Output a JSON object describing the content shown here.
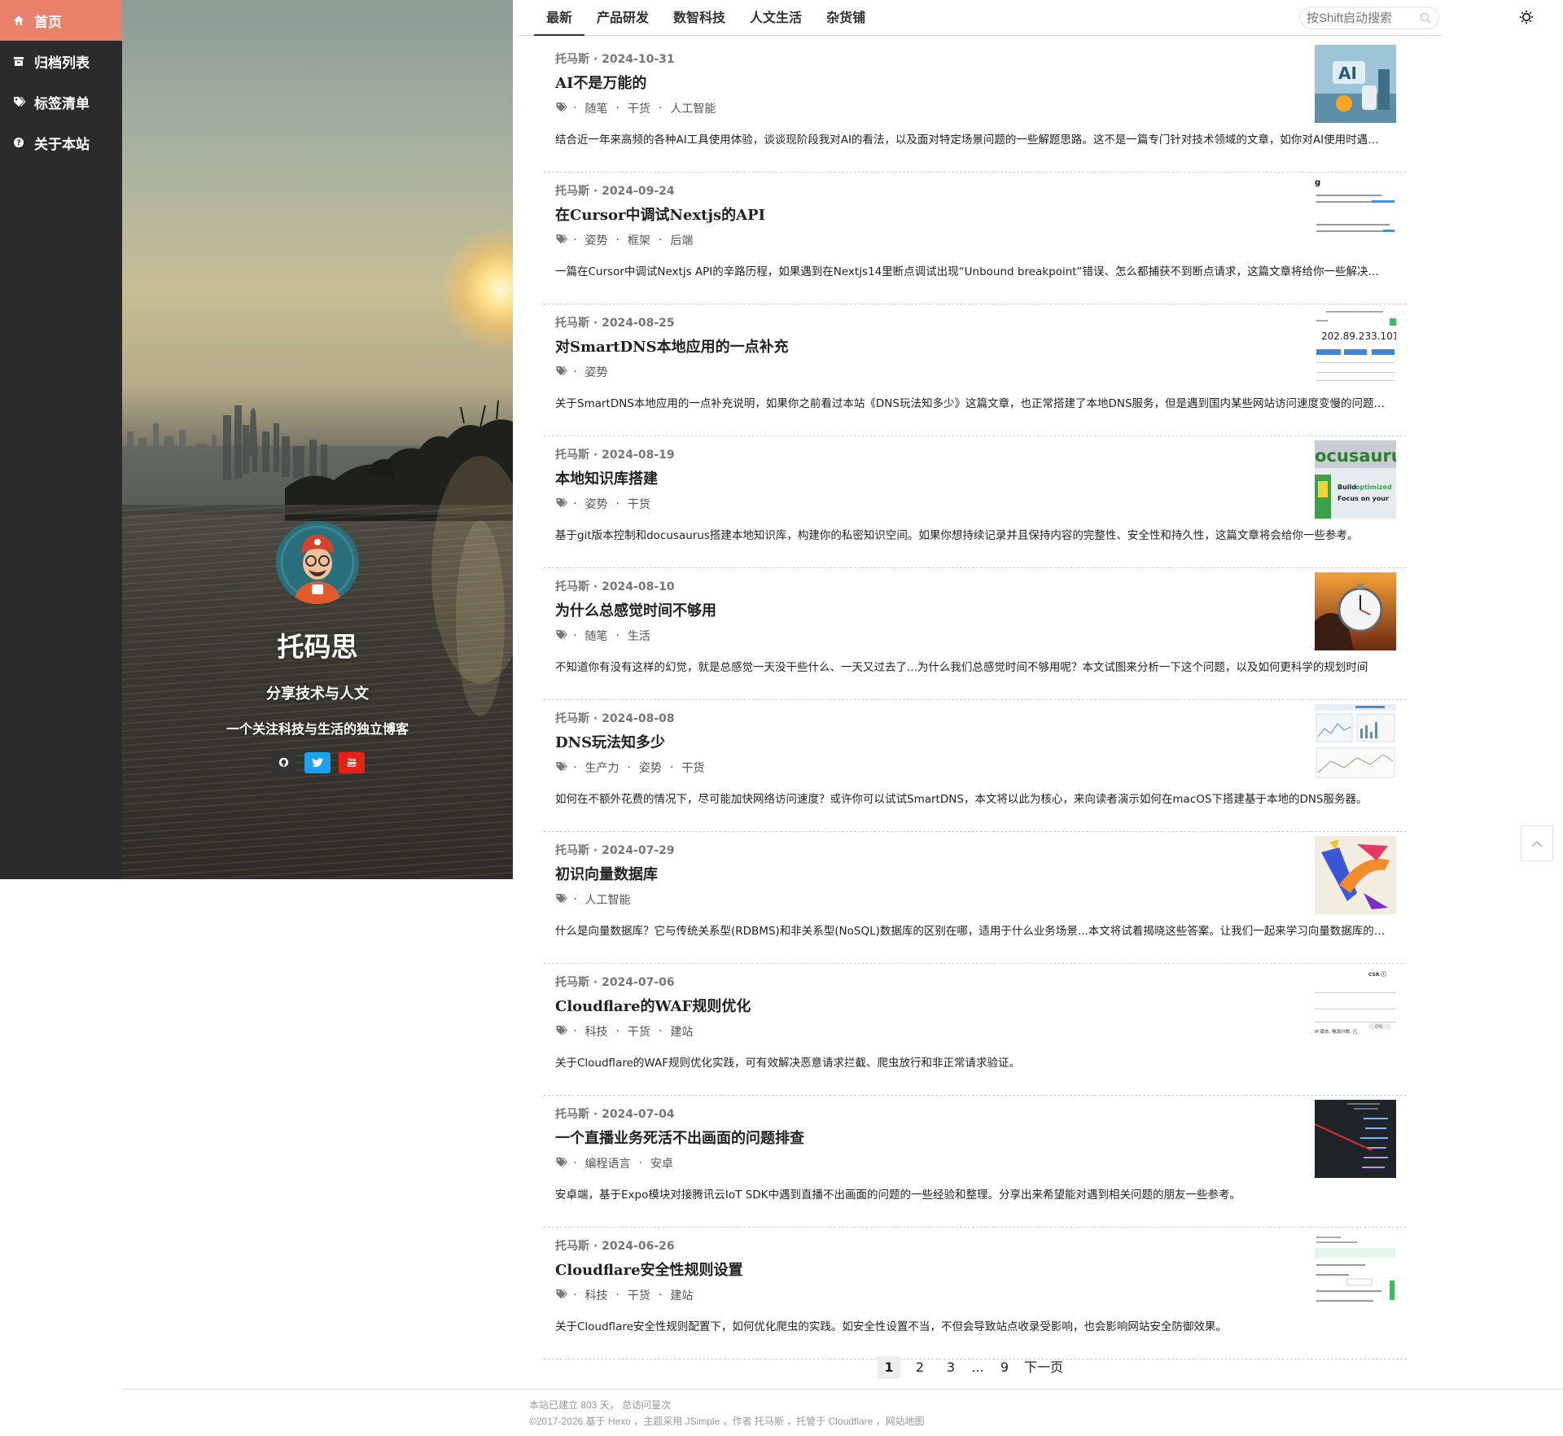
{
  "nav": {
    "items": [
      {
        "label": "首页",
        "icon": "home-icon",
        "active": true
      },
      {
        "label": "归档列表",
        "icon": "archive-icon"
      },
      {
        "label": "标签清单",
        "icon": "tags-icon"
      },
      {
        "label": "关于本站",
        "icon": "question-circle-icon"
      }
    ],
    "active_color": "#e8806a",
    "background": "#2b2b2b"
  },
  "profile": {
    "name": "托码思",
    "slogan": "分享技术与人文",
    "description": "一个关注科技与生活的独立博客",
    "social": [
      {
        "icon": "github-icon",
        "color": "#333333"
      },
      {
        "icon": "twitter-icon",
        "color": "#1da1f2"
      },
      {
        "icon": "youtube-icon",
        "color": "#e62117"
      }
    ]
  },
  "header": {
    "tabs": [
      {
        "label": "最新",
        "active": true
      },
      {
        "label": "产品研发"
      },
      {
        "label": "数智科技"
      },
      {
        "label": "人文生活"
      },
      {
        "label": "杂货铺"
      }
    ],
    "search_placeholder": "按Shift启动搜索"
  },
  "posts": [
    {
      "author": "托马斯",
      "date": "2024-10-31",
      "title": "AI不是万能的",
      "tags": [
        "随笔",
        "干货",
        "人工智能"
      ],
      "summary": "结合近一年来高频的各种AI工具使用体验，谈谈现阶段我对AI的看法，以及面对特定场景问题的一些解题思路。这不是一篇专门针对技术领域的文章，如你对AI使用时遇到过困惑，不妨读读这篇文章",
      "thumb": "ai-robots"
    },
    {
      "author": "托马斯",
      "date": "2024-09-24",
      "title": "在Cursor中调试Nextjs的API",
      "tags": [
        "姿势",
        "框架",
        "后端"
      ],
      "summary": "一篇在Cursor中调试Nextjs API的辛路历程，如果遇到在Nextjs14里断点调试出现“Unbound breakpoint”错误、怎么都捕获不到断点请求，这篇文章将给你一些解决方案",
      "thumb": "doc-text"
    },
    {
      "author": "托马斯",
      "date": "2024-08-25",
      "title": "对SmartDNS本地应用的一点补充",
      "tags": [
        "姿势"
      ],
      "summary": "关于SmartDNS本地应用的一点补充说明，如果你之前看过本站《DNS玩法知多少》这篇文章，也正常搭建了本地DNS服务，但是遇到国内某些网站访问速度变慢的问题，本文也许能给到你解决方法",
      "thumb": "ip-panel",
      "thumb_text": "202.89.233.101"
    },
    {
      "author": "托马斯",
      "date": "2024-08-19",
      "title": "本地知识库搭建",
      "tags": [
        "姿势",
        "干货"
      ],
      "summary": "基于git版本控制和docusaurus搭建本地知识库，构建你的私密知识空间。如果你想持续记录并且保持内容的完整性、安全性和持久性，这篇文章将会给你一些参考。",
      "thumb": "docusaurus",
      "thumb_text": "ocusauru"
    },
    {
      "author": "托马斯",
      "date": "2024-08-10",
      "title": "为什么总感觉时间不够用",
      "tags": [
        "随笔",
        "生活"
      ],
      "summary": "不知道你有没有这样的幻觉，就是总感觉一天没干些什么、一天又过去了...为什么我们总感觉时间不够用呢？本文试图来分析一下这个问题，以及如何更科学的规划时间",
      "thumb": "stopwatch"
    },
    {
      "author": "托马斯",
      "date": "2024-08-08",
      "title": "DNS玩法知多少",
      "tags": [
        "生产力",
        "姿势",
        "干货"
      ],
      "summary": "如何在不额外花费的情况下，尽可能加快网络访问速度？或许你可以试试SmartDNS，本文将以此为核心，来向读者演示如何在macOS下搭建基于本地的DNS服务器。",
      "thumb": "dashboard"
    },
    {
      "author": "托马斯",
      "date": "2024-07-29",
      "title": "初识向量数据库",
      "tags": [
        "人工智能"
      ],
      "summary": "什么是向量数据库？它与传统关系型(RDBMS)和非关系型(NoSQL)数据库的区别在哪，适用于什么业务场景...本文将试着揭晓这些答案。让我们一起来学习向量数据库的基本知识吧",
      "thumb": "arrows"
    },
    {
      "author": "托马斯",
      "date": "2024-07-06",
      "title": "Cloudflare的WAF规则优化",
      "tags": [
        "科技",
        "干货",
        "建站"
      ],
      "summary": "关于Cloudflare的WAF规则优化实践，可有效解决恶意请求拦截、爬虫放行和非正常请求验证。",
      "thumb": "waf-panel"
    },
    {
      "author": "托马斯",
      "date": "2024-07-04",
      "title": "一个直播业务死活不出画面的问题排查",
      "tags": [
        "编程语言",
        "安卓"
      ],
      "summary": "安卓端，基于Expo模块对接腾讯云IoT SDK中遇到直播不出画面的问题的一些经验和整理。分享出来希望能对遇到相关问题的朋友一些参考。",
      "thumb": "code-dark"
    },
    {
      "author": "托马斯",
      "date": "2024-06-26",
      "title": "Cloudflare安全性规则设置",
      "tags": [
        "科技",
        "干货",
        "建站"
      ],
      "summary": "关于Cloudflare安全性规则配置下，如何优化爬虫的实践。如安全性设置不当，不但会导致站点收录受影响，也会影响网站安全防御效果。",
      "thumb": "settings-panel"
    }
  ],
  "pagination": {
    "pages": [
      "1",
      "2",
      "3"
    ],
    "ellipsis": "...",
    "last": "9",
    "next": "下一页",
    "current": "1"
  },
  "footer": {
    "line1": "本站已建立 803 天， 总访问量次",
    "line2": "©2017-2026 基于 Hexo ，主题采用 JSimple ，作者 托马斯 ，托管于 Cloudflare ，网站地图"
  }
}
